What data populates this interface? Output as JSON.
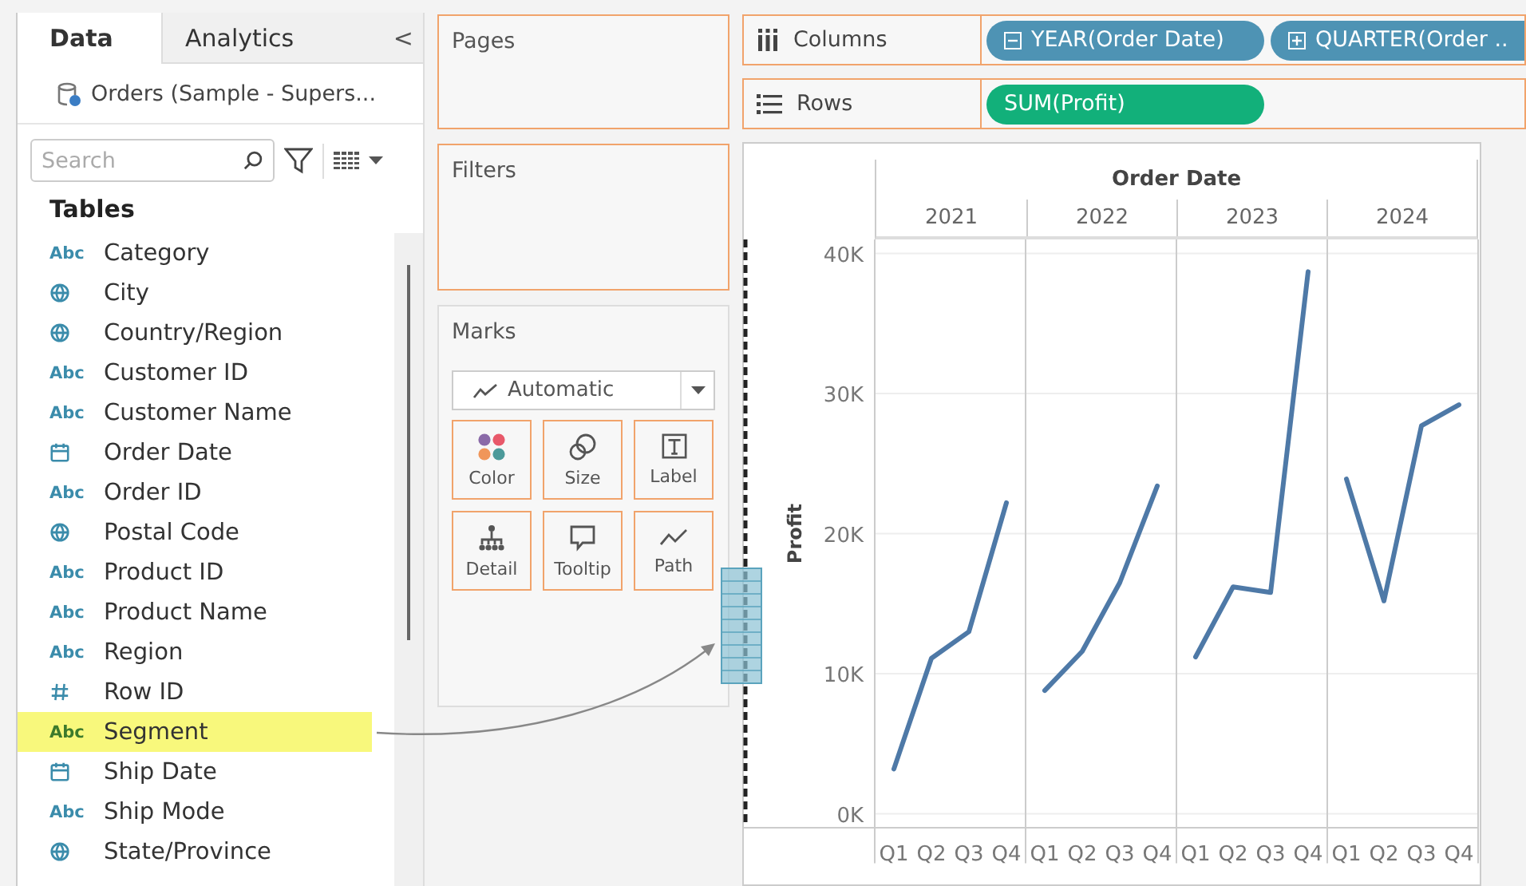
{
  "sidebar": {
    "tabs": [
      {
        "label": "Data",
        "selected": true
      },
      {
        "label": "Analytics",
        "selected": false
      }
    ],
    "collapse": "<",
    "datasource": "Orders (Sample - Supers...",
    "search": {
      "placeholder": "Search"
    },
    "section": "Tables",
    "fields": [
      {
        "kind": "string",
        "type_label": "Abc",
        "name": "Category",
        "selected": false
      },
      {
        "kind": "geo",
        "name": "City",
        "selected": false
      },
      {
        "kind": "geo",
        "name": "Country/Region",
        "selected": false
      },
      {
        "kind": "string",
        "type_label": "Abc",
        "name": "Customer ID",
        "selected": false
      },
      {
        "kind": "string",
        "type_label": "Abc",
        "name": "Customer Name",
        "selected": false
      },
      {
        "kind": "date",
        "name": "Order Date",
        "selected": false
      },
      {
        "kind": "string",
        "type_label": "Abc",
        "name": "Order ID",
        "selected": false
      },
      {
        "kind": "geo",
        "name": "Postal Code",
        "selected": false
      },
      {
        "kind": "string",
        "type_label": "Abc",
        "name": "Product ID",
        "selected": false
      },
      {
        "kind": "string",
        "type_label": "Abc",
        "name": "Product Name",
        "selected": false
      },
      {
        "kind": "string",
        "type_label": "Abc",
        "name": "Region",
        "selected": false
      },
      {
        "kind": "number",
        "name": "Row ID",
        "selected": false
      },
      {
        "kind": "string",
        "type_label": "Abc",
        "name": "Segment",
        "selected": true
      },
      {
        "kind": "date",
        "name": "Ship Date",
        "selected": false
      },
      {
        "kind": "string",
        "type_label": "Abc",
        "name": "Ship Mode",
        "selected": false
      },
      {
        "kind": "geo",
        "name": "State/Province",
        "selected": false
      }
    ]
  },
  "cards": {
    "pages": "Pages",
    "filters": "Filters",
    "marks": {
      "title": "Marks",
      "mark_type": "Automatic",
      "buttons": [
        {
          "kind": "color",
          "label": "Color"
        },
        {
          "kind": "size",
          "label": "Size"
        },
        {
          "kind": "label",
          "label": "Label"
        },
        {
          "kind": "detail",
          "label": "Detail"
        },
        {
          "kind": "tooltip",
          "label": "Tooltip"
        },
        {
          "kind": "path",
          "label": "Path"
        }
      ]
    }
  },
  "shelves": [
    {
      "kind": "columns",
      "label": "Columns",
      "pills": [
        {
          "text": "YEAR(Order Date)",
          "kind": "dimension",
          "expanded": true
        },
        {
          "text": "QUARTER(Order ..",
          "kind": "dimension",
          "expanded": false
        }
      ]
    },
    {
      "kind": "rows",
      "label": "Rows",
      "pills": [
        {
          "text": "SUM(Profit)",
          "kind": "measure"
        }
      ]
    }
  ],
  "view": {
    "header": "Order Date",
    "years": [
      "2021",
      "2022",
      "2023",
      "2024"
    ],
    "chart_data": {
      "type": "line",
      "ylabel": "Profit",
      "grid": true,
      "categories": [
        "Q1",
        "Q2",
        "Q3",
        "Q4",
        "Q1",
        "Q2",
        "Q3",
        "Q4",
        "Q1",
        "Q2",
        "Q3",
        "Q4",
        "Q1",
        "Q2",
        "Q3",
        "Q4"
      ],
      "ylim": [
        -1000,
        41000
      ],
      "yticks": [
        {
          "value": 0,
          "label": "0K"
        },
        {
          "value": 10000,
          "label": "10K"
        },
        {
          "value": 20000,
          "label": "20K"
        },
        {
          "value": 30000,
          "label": "30K"
        },
        {
          "value": 40000,
          "label": "40K"
        }
      ],
      "series": [
        {
          "color": "#4e79a7",
          "values": [
            3200,
            11100,
            13000,
            22200,
            8800,
            11600,
            16500,
            23400,
            11200,
            16200,
            15800,
            38700,
            23900,
            15200,
            27700,
            29200
          ]
        }
      ]
    }
  }
}
